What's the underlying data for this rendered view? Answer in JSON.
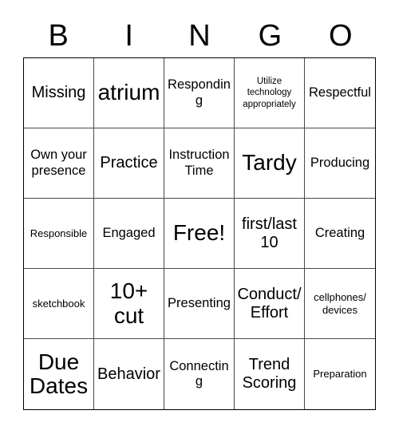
{
  "card": {
    "type": "bingo-card",
    "columns": 5,
    "rows": 5,
    "background_color": "#ffffff",
    "text_color": "#000000",
    "outer_border_color": "#000000",
    "inner_grid_color": "#4a4a4a"
  },
  "header": {
    "letters": [
      "B",
      "I",
      "N",
      "G",
      "O"
    ]
  },
  "grid": {
    "rows": [
      {
        "cells": [
          {
            "text": "Missing",
            "size": "lg"
          },
          {
            "text": "atrium",
            "size": "xl"
          },
          {
            "text": "Responding",
            "size": "md"
          },
          {
            "text": "Utilize technology appropriately",
            "size": "xs"
          },
          {
            "text": "Respectful",
            "size": "md"
          }
        ]
      },
      {
        "cells": [
          {
            "text": "Own your presence",
            "size": "md"
          },
          {
            "text": "Practice",
            "size": "lg"
          },
          {
            "text": "Instruction Time",
            "size": "md"
          },
          {
            "text": "Tardy",
            "size": "xl"
          },
          {
            "text": "Producing",
            "size": "md"
          }
        ]
      },
      {
        "cells": [
          {
            "text": "Responsible",
            "size": "sm"
          },
          {
            "text": "Engaged",
            "size": "md"
          },
          {
            "text": "Free!",
            "size": "xl"
          },
          {
            "text": "first/last 10",
            "size": "lg"
          },
          {
            "text": "Creating",
            "size": "md"
          }
        ]
      },
      {
        "cells": [
          {
            "text": "sketchbook",
            "size": "sm"
          },
          {
            "text": "10+ cut",
            "size": "xl"
          },
          {
            "text": "Presenting",
            "size": "md"
          },
          {
            "text": "Conduct/ Effort",
            "size": "lg"
          },
          {
            "text": "cellphones/ devices",
            "size": "sm"
          }
        ]
      },
      {
        "cells": [
          {
            "text": "Due Dates",
            "size": "xl"
          },
          {
            "text": "Behavior",
            "size": "lg"
          },
          {
            "text": "Connecting",
            "size": "md"
          },
          {
            "text": "Trend Scoring",
            "size": "lg"
          },
          {
            "text": "Preparation",
            "size": "sm"
          }
        ]
      }
    ]
  }
}
